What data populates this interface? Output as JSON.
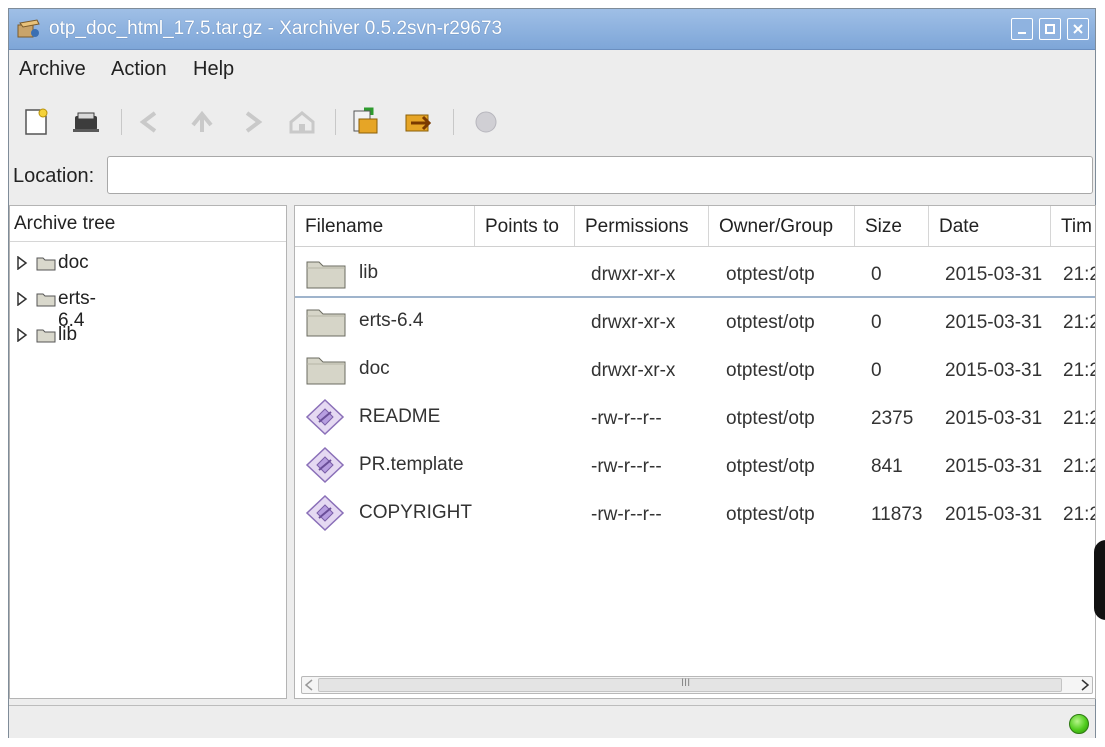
{
  "window": {
    "title": "otp_doc_html_17.5.tar.gz - Xarchiver 0.5.2svn-r29673",
    "controls": {
      "minimize": "minimize-icon",
      "maximize": "maximize-icon",
      "close": "close-icon"
    }
  },
  "menu": {
    "items": [
      "Archive",
      "Action",
      "Help"
    ]
  },
  "toolbar": {
    "icons": [
      "new-archive-icon",
      "open-archive-icon",
      "back-icon",
      "up-icon",
      "forward-icon",
      "home-icon",
      "extract-icon",
      "add-icon",
      "stop-icon"
    ]
  },
  "location": {
    "label": "Location:",
    "value": ""
  },
  "tree": {
    "header": "Archive tree",
    "items": [
      {
        "label": "doc"
      },
      {
        "label": "erts-6.4"
      },
      {
        "label": "lib"
      }
    ]
  },
  "files": {
    "columns": [
      "Filename",
      "Points to",
      "Permissions",
      "Owner/Group",
      "Size",
      "Date",
      "Tim"
    ],
    "rows": [
      {
        "icon": "folder-icon",
        "name": "lib",
        "points_to": "",
        "permissions": "drwxr-xr-x",
        "owner": "otptest/otp",
        "size": "0",
        "date": "2015-03-31",
        "time": "21:2"
      },
      {
        "icon": "folder-icon",
        "name": "erts-6.4",
        "points_to": "",
        "permissions": "drwxr-xr-x",
        "owner": "otptest/otp",
        "size": "0",
        "date": "2015-03-31",
        "time": "21:2"
      },
      {
        "icon": "folder-icon",
        "name": "doc",
        "points_to": "",
        "permissions": "drwxr-xr-x",
        "owner": "otptest/otp",
        "size": "0",
        "date": "2015-03-31",
        "time": "21:2"
      },
      {
        "icon": "file-icon",
        "name": "README",
        "points_to": "",
        "permissions": "-rw-r--r--",
        "owner": "otptest/otp",
        "size": "2375",
        "date": "2015-03-31",
        "time": "21:2"
      },
      {
        "icon": "file-icon",
        "name": "PR.template",
        "points_to": "",
        "permissions": "-rw-r--r--",
        "owner": "otptest/otp",
        "size": "841",
        "date": "2015-03-31",
        "time": "21:2"
      },
      {
        "icon": "file-icon",
        "name": "COPYRIGHT",
        "points_to": "",
        "permissions": "-rw-r--r--",
        "owner": "otptest/otp",
        "size": "11873",
        "date": "2015-03-31",
        "time": "21:2"
      }
    ]
  },
  "scrollbar": {
    "thumb_grip": "III"
  },
  "status": {
    "text": "",
    "indicator": "status-led-icon",
    "indicator_color": "#4fcc1c"
  },
  "colors": {
    "titlebar": "#8fb3e0",
    "selected_line": "#9fb4cc"
  }
}
